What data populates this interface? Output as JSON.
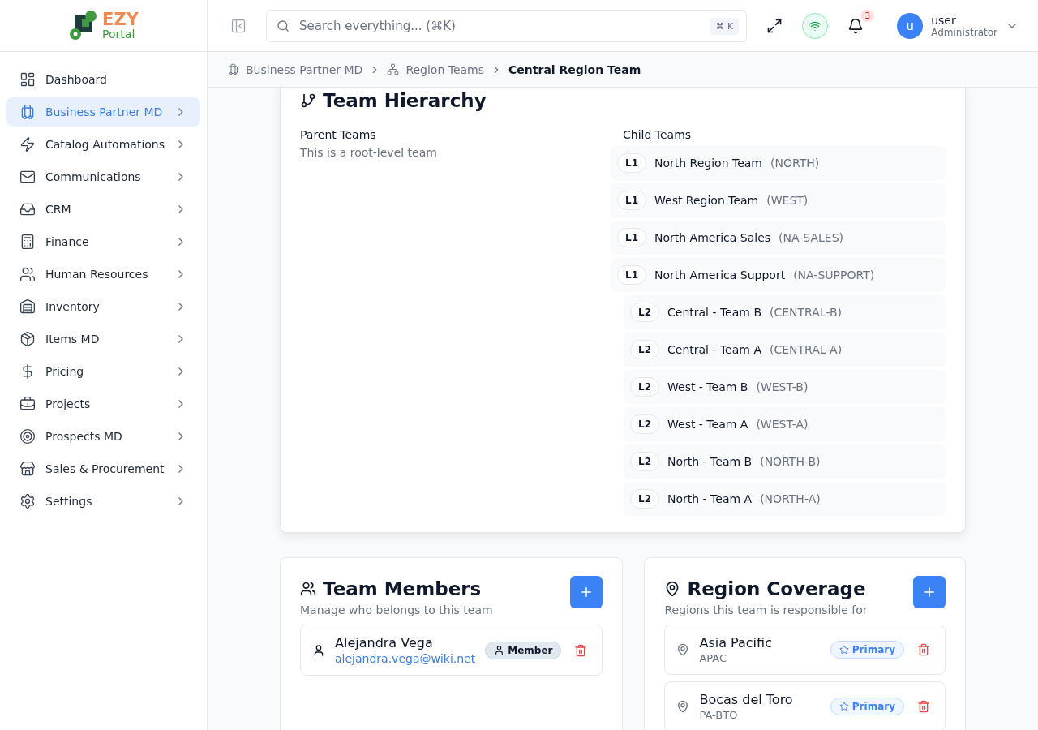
{
  "logo": {
    "line_1": "EZY",
    "line_2": "Portal"
  },
  "sidebar": {
    "items": [
      {
        "label": "Dashboard",
        "selected": false,
        "has_submenu": false
      },
      {
        "label": "Business Partner MD",
        "selected": true,
        "has_submenu": true
      },
      {
        "label": "Catalog Automations",
        "selected": false,
        "has_submenu": true
      },
      {
        "label": "Communications",
        "selected": false,
        "has_submenu": true
      },
      {
        "label": "CRM",
        "selected": false,
        "has_submenu": true
      },
      {
        "label": "Finance",
        "selected": false,
        "has_submenu": true
      },
      {
        "label": "Human Resources",
        "selected": false,
        "has_submenu": true
      },
      {
        "label": "Inventory",
        "selected": false,
        "has_submenu": true
      },
      {
        "label": "Items MD",
        "selected": false,
        "has_submenu": true
      },
      {
        "label": "Pricing",
        "selected": false,
        "has_submenu": true
      },
      {
        "label": "Projects",
        "selected": false,
        "has_submenu": true
      },
      {
        "label": "Prospects MD",
        "selected": false,
        "has_submenu": true
      },
      {
        "label": "Sales & Procurement",
        "selected": false,
        "has_submenu": true
      },
      {
        "label": "Settings",
        "selected": false,
        "has_submenu": true
      }
    ]
  },
  "header": {
    "search": {
      "placeholder": "Search everything... (⌘K)",
      "shortcut": "⌘ K"
    },
    "notifications": {
      "count": "3"
    },
    "user": {
      "avatar": "u",
      "name": "user",
      "role": "Administrator"
    }
  },
  "breadcrumb": [
    {
      "label": "Business Partner MD",
      "current": false
    },
    {
      "label": "Region Teams",
      "current": false
    },
    {
      "label": "Central Region Team",
      "current": true
    }
  ],
  "hierarchy": {
    "title": "Team Hierarchy",
    "parent_teams": {
      "heading": "Parent Teams",
      "empty_text": "This is a root-level team"
    },
    "child_teams": {
      "heading": "Child Teams",
      "items": [
        {
          "level": "L1",
          "name": "North Region Team",
          "code": "(NORTH)"
        },
        {
          "level": "L1",
          "name": "West Region Team",
          "code": "(WEST)"
        },
        {
          "level": "L1",
          "name": "North America Sales",
          "code": "(NA-SALES)"
        },
        {
          "level": "L1",
          "name": "North America Support",
          "code": "(NA-SUPPORT)",
          "children": [
            {
              "level": "L2",
              "name": "Central - Team B",
              "code": "(CENTRAL-B)"
            },
            {
              "level": "L2",
              "name": "Central - Team A",
              "code": "(CENTRAL-A)"
            },
            {
              "level": "L2",
              "name": "West - Team B",
              "code": "(WEST-B)"
            },
            {
              "level": "L2",
              "name": "West - Team A",
              "code": "(WEST-A)"
            },
            {
              "level": "L2",
              "name": "North - Team B",
              "code": "(NORTH-B)"
            },
            {
              "level": "L2",
              "name": "North - Team A",
              "code": "(NORTH-A)"
            }
          ]
        }
      ]
    }
  },
  "members": {
    "title": "Team Members",
    "subtitle": "Manage who belongs to this team",
    "items": [
      {
        "name": "Alejandra Vega",
        "email": "alejandra.vega@wiki.net",
        "role": "Member"
      }
    ]
  },
  "coverage": {
    "title": "Region Coverage",
    "subtitle": "Regions this team is responsible for",
    "items": [
      {
        "name": "Asia Pacific",
        "code": "APAC",
        "badge": "Primary"
      },
      {
        "name": "Bocas del Toro",
        "code": "PA-BTO",
        "badge": "Primary"
      }
    ]
  }
}
